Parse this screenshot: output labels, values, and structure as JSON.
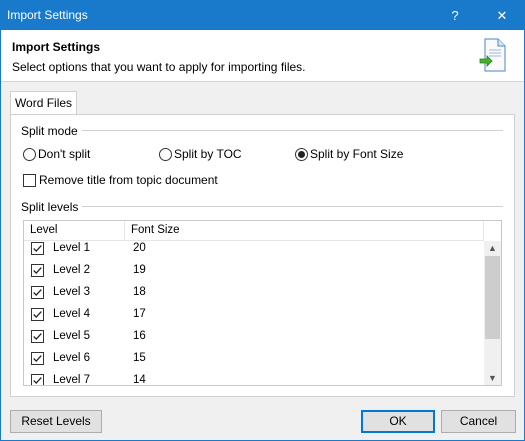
{
  "window": {
    "title": "Import Settings",
    "help_glyph": "?",
    "close_glyph": "✕"
  },
  "header": {
    "title": "Import Settings",
    "subtitle": "Select options that you want to apply for importing files.",
    "icon": "document-import-icon"
  },
  "tabs": [
    {
      "label": "Word Files",
      "active": true
    }
  ],
  "split_mode": {
    "group_label": "Split mode",
    "options": [
      {
        "label": "Don't split",
        "selected": false
      },
      {
        "label": "Split by TOC",
        "selected": false
      },
      {
        "label": "Split by Font Size",
        "selected": true
      }
    ],
    "remove_title": {
      "label": "Remove title from topic document",
      "checked": false
    }
  },
  "split_levels": {
    "group_label": "Split levels",
    "columns": [
      "Level",
      "Font Size"
    ],
    "rows": [
      {
        "level": "Level 1",
        "font_size": "20",
        "checked": true
      },
      {
        "level": "Level 2",
        "font_size": "19",
        "checked": true
      },
      {
        "level": "Level 3",
        "font_size": "18",
        "checked": true
      },
      {
        "level": "Level 4",
        "font_size": "17",
        "checked": true
      },
      {
        "level": "Level 5",
        "font_size": "16",
        "checked": true
      },
      {
        "level": "Level 6",
        "font_size": "15",
        "checked": true
      },
      {
        "level": "Level 7",
        "font_size": "14",
        "checked": true
      }
    ]
  },
  "buttons": {
    "reset": "Reset Levels",
    "ok": "OK",
    "cancel": "Cancel"
  },
  "colors": {
    "titlebar": "#1979ca",
    "accent": "#0078d7"
  }
}
